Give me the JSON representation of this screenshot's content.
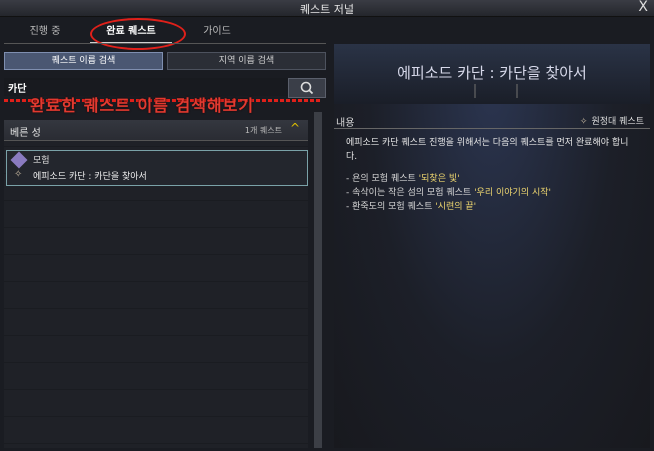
{
  "window": {
    "title": "퀘스트 저널",
    "close_label": "X"
  },
  "tabs": [
    {
      "label": "진행 중"
    },
    {
      "label": "완료 퀘스트"
    },
    {
      "label": "가이드"
    }
  ],
  "subtabs": [
    {
      "label": "퀘스트 이름 검색"
    },
    {
      "label": "지역 이름 검색"
    }
  ],
  "search": {
    "value": "카단",
    "placeholder": ""
  },
  "annotation": "완료한 퀘스트 이름 검색해보기",
  "list": {
    "group": {
      "name": "베른 성",
      "count": "1개 퀘스트",
      "caret": "^"
    },
    "items": [
      {
        "category": "모험",
        "name": "에피소드 카단 : 카단을 찾아서"
      }
    ]
  },
  "detail": {
    "title": "에피소드 카단 : 카단을 찾아서",
    "content_label": "내용",
    "reward_label": "원정대 퀘스트",
    "description": "에피소드 카단 퀘스트 진행을 위해서는 다음의 퀘스트를 먼저 완료해야 합니다.",
    "requirements": [
      {
        "prefix": "- 욘의 모험 퀘스트 ",
        "quest": "'되찾은 빛'"
      },
      {
        "prefix": "- 속삭이는 작은 섬의 모험 퀘스트 ",
        "quest": "'우리 이야기의 시작'"
      },
      {
        "prefix": "- 환죽도의 모험 퀘스트 ",
        "quest": "'시련의 끝'"
      }
    ]
  }
}
